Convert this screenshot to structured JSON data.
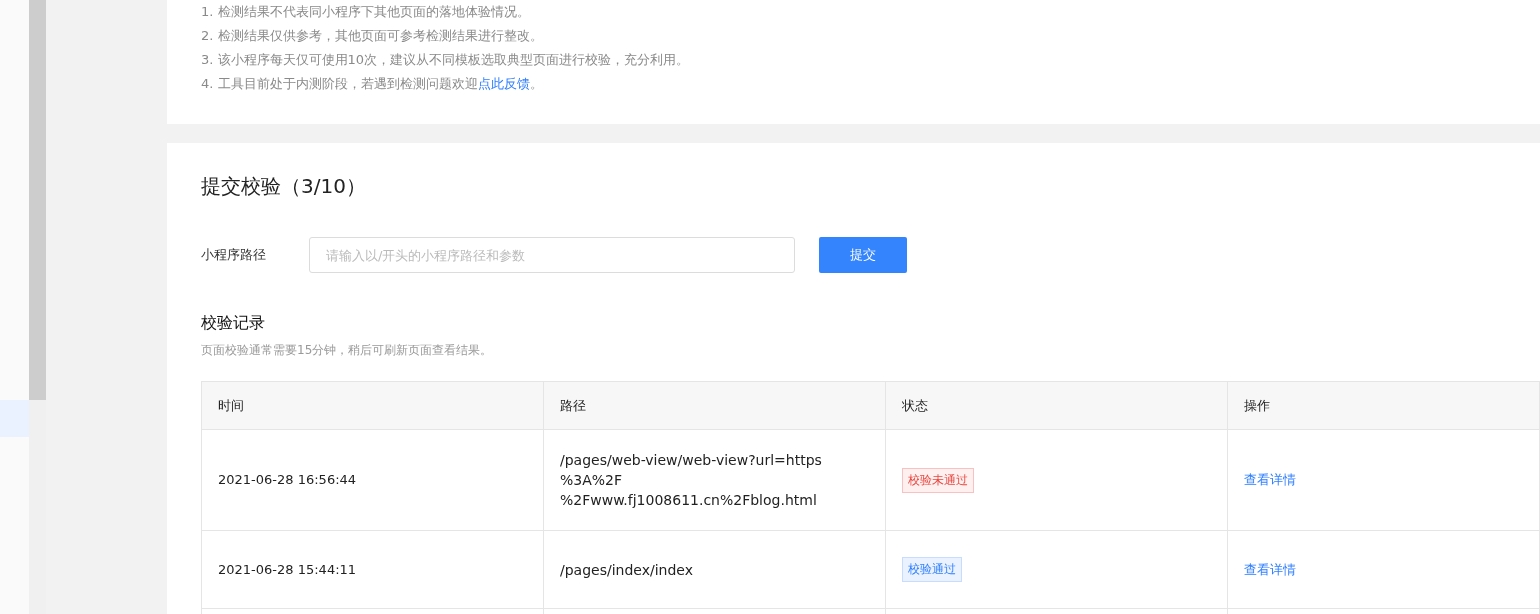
{
  "sidebar": {
    "items": [
      {
        "selected": true
      }
    ]
  },
  "notes": {
    "items": [
      "1. 检测结果不代表同小程序下其他页面的落地体验情况。",
      "2. 检测结果仅供参考，其他页面可参考检测结果进行整改。",
      "3. 该小程序每天仅可使用10次，建议从不同模板选取典型页面进行校验，充分利用。",
      "4. 工具目前处于内测阶段，若遇到检测问题欢迎"
    ],
    "link": "点此反馈",
    "link_suffix": "。"
  },
  "submit": {
    "title": "提交校验（3/10）",
    "field_label": "小程序路径",
    "placeholder": "请输入以/开头的小程序路径和参数",
    "button": "提交"
  },
  "records": {
    "title": "校验记录",
    "hint": "页面校验通常需要15分钟，稍后可刷新页面查看结果。",
    "table": {
      "columns": [
        "时间",
        "路径",
        "状态",
        "操作"
      ],
      "rows": [
        {
          "time": "2021-06-28 16:56:44",
          "path": [
            "/pages/web-view/web-view?url=https",
            "%3A%2F",
            "%2Fwww.fj1008611.cn%2Fblog.html"
          ],
          "status": {
            "kind": "fail",
            "label": "校验未通过"
          },
          "action": "查看详情"
        },
        {
          "time": "2021-06-28 15:44:11",
          "path": [
            "/pages/index/index"
          ],
          "status": {
            "kind": "pass",
            "label": "校验通过"
          },
          "action": "查看详情"
        }
      ]
    }
  }
}
